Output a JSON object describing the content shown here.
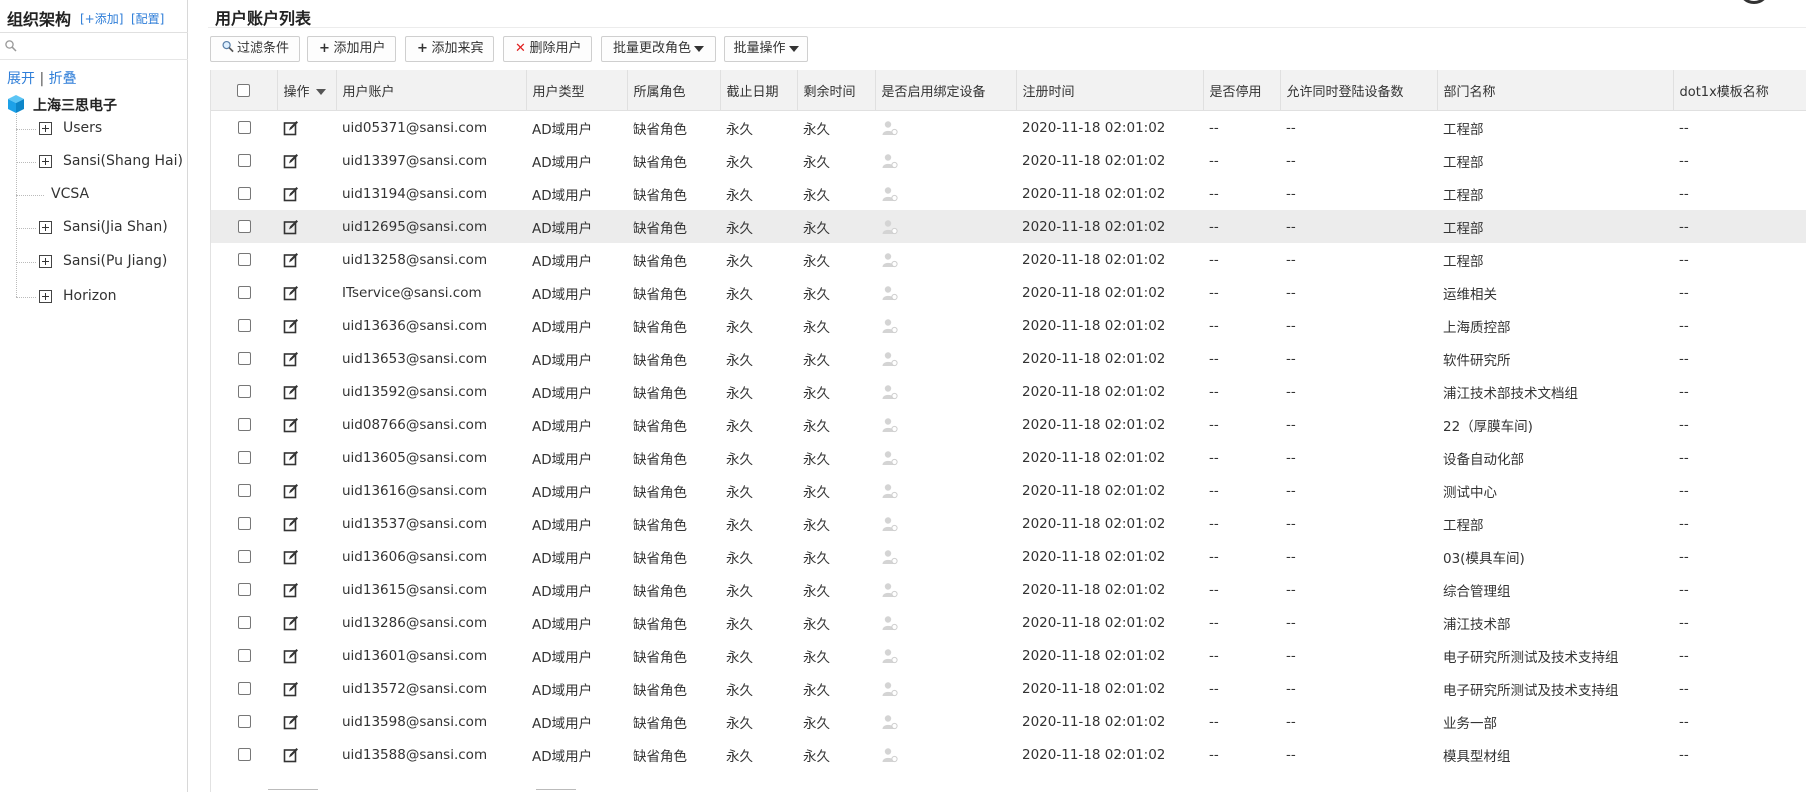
{
  "org": {
    "title": "组织架构",
    "add_label": "[+添加]",
    "config_label": "[配置]",
    "expand_label": "展开",
    "separator": "|",
    "collapse_label": "折叠",
    "root_label": "上海三思电子",
    "nodes": [
      {
        "label": "Users",
        "expandable": true
      },
      {
        "label": "Sansi(Shang Hai)",
        "expandable": true
      },
      {
        "label": "VCSA",
        "expandable": false
      },
      {
        "label": "Sansi(Jia Shan)",
        "expandable": true
      },
      {
        "label": "Sansi(Pu Jiang)",
        "expandable": true
      },
      {
        "label": "Horizon",
        "expandable": true
      }
    ]
  },
  "page": {
    "title": "用户账户列表"
  },
  "toolbar": {
    "filter": "过滤条件",
    "add_user": "添加用户",
    "add_guest": "添加来宾",
    "delete_user": "删除用户",
    "batch_role": "批量更改角色",
    "batch_ops": "批量操作"
  },
  "table": {
    "headers": {
      "op": "操作",
      "account": "用户账户",
      "type": "用户类型",
      "role": "所属角色",
      "deadline": "截止日期",
      "remaining": "剩余时间",
      "bind_device": "是否启用绑定设备",
      "reg_time": "注册时间",
      "disabled": "是否停用",
      "concurrent": "允许同时登陆设备数",
      "dept": "部门名称",
      "dot1x": "dot1x模板名称"
    },
    "rows": [
      {
        "account": "uid05371@sansi.com",
        "type": "AD域用户",
        "role": "缺省角色",
        "deadline": "永久",
        "remaining": "永久",
        "reg_time": "2020-11-18 02:01:02",
        "disabled": "--",
        "concurrent": "--",
        "dept": "工程部",
        "dot1x": "--"
      },
      {
        "account": "uid13397@sansi.com",
        "type": "AD域用户",
        "role": "缺省角色",
        "deadline": "永久",
        "remaining": "永久",
        "reg_time": "2020-11-18 02:01:02",
        "disabled": "--",
        "concurrent": "--",
        "dept": "工程部",
        "dot1x": "--"
      },
      {
        "account": "uid13194@sansi.com",
        "type": "AD域用户",
        "role": "缺省角色",
        "deadline": "永久",
        "remaining": "永久",
        "reg_time": "2020-11-18 02:01:02",
        "disabled": "--",
        "concurrent": "--",
        "dept": "工程部",
        "dot1x": "--"
      },
      {
        "account": "uid12695@sansi.com",
        "type": "AD域用户",
        "role": "缺省角色",
        "deadline": "永久",
        "remaining": "永久",
        "reg_time": "2020-11-18 02:01:02",
        "disabled": "--",
        "concurrent": "--",
        "dept": "工程部",
        "dot1x": "--"
      },
      {
        "account": "uid13258@sansi.com",
        "type": "AD域用户",
        "role": "缺省角色",
        "deadline": "永久",
        "remaining": "永久",
        "reg_time": "2020-11-18 02:01:02",
        "disabled": "--",
        "concurrent": "--",
        "dept": "工程部",
        "dot1x": "--"
      },
      {
        "account": "ITservice@sansi.com",
        "type": "AD域用户",
        "role": "缺省角色",
        "deadline": "永久",
        "remaining": "永久",
        "reg_time": "2020-11-18 02:01:02",
        "disabled": "--",
        "concurrent": "--",
        "dept": "运维相关",
        "dot1x": "--"
      },
      {
        "account": "uid13636@sansi.com",
        "type": "AD域用户",
        "role": "缺省角色",
        "deadline": "永久",
        "remaining": "永久",
        "reg_time": "2020-11-18 02:01:02",
        "disabled": "--",
        "concurrent": "--",
        "dept": "上海质控部",
        "dot1x": "--"
      },
      {
        "account": "uid13653@sansi.com",
        "type": "AD域用户",
        "role": "缺省角色",
        "deadline": "永久",
        "remaining": "永久",
        "reg_time": "2020-11-18 02:01:02",
        "disabled": "--",
        "concurrent": "--",
        "dept": "软件研究所",
        "dot1x": "--"
      },
      {
        "account": "uid13592@sansi.com",
        "type": "AD域用户",
        "role": "缺省角色",
        "deadline": "永久",
        "remaining": "永久",
        "reg_time": "2020-11-18 02:01:02",
        "disabled": "--",
        "concurrent": "--",
        "dept": "浦江技术部技术文档组",
        "dot1x": "--"
      },
      {
        "account": "uid08766@sansi.com",
        "type": "AD域用户",
        "role": "缺省角色",
        "deadline": "永久",
        "remaining": "永久",
        "reg_time": "2020-11-18 02:01:02",
        "disabled": "--",
        "concurrent": "--",
        "dept": "22（厚膜车间)",
        "dot1x": "--"
      },
      {
        "account": "uid13605@sansi.com",
        "type": "AD域用户",
        "role": "缺省角色",
        "deadline": "永久",
        "remaining": "永久",
        "reg_time": "2020-11-18 02:01:02",
        "disabled": "--",
        "concurrent": "--",
        "dept": "设备自动化部",
        "dot1x": "--"
      },
      {
        "account": "uid13616@sansi.com",
        "type": "AD域用户",
        "role": "缺省角色",
        "deadline": "永久",
        "remaining": "永久",
        "reg_time": "2020-11-18 02:01:02",
        "disabled": "--",
        "concurrent": "--",
        "dept": "测试中心",
        "dot1x": "--"
      },
      {
        "account": "uid13537@sansi.com",
        "type": "AD域用户",
        "role": "缺省角色",
        "deadline": "永久",
        "remaining": "永久",
        "reg_time": "2020-11-18 02:01:02",
        "disabled": "--",
        "concurrent": "--",
        "dept": "工程部",
        "dot1x": "--"
      },
      {
        "account": "uid13606@sansi.com",
        "type": "AD域用户",
        "role": "缺省角色",
        "deadline": "永久",
        "remaining": "永久",
        "reg_time": "2020-11-18 02:01:02",
        "disabled": "--",
        "concurrent": "--",
        "dept": "03(模具车间)",
        "dot1x": "--"
      },
      {
        "account": "uid13615@sansi.com",
        "type": "AD域用户",
        "role": "缺省角色",
        "deadline": "永久",
        "remaining": "永久",
        "reg_time": "2020-11-18 02:01:02",
        "disabled": "--",
        "concurrent": "--",
        "dept": "综合管理组",
        "dot1x": "--"
      },
      {
        "account": "uid13286@sansi.com",
        "type": "AD域用户",
        "role": "缺省角色",
        "deadline": "永久",
        "remaining": "永久",
        "reg_time": "2020-11-18 02:01:02",
        "disabled": "--",
        "concurrent": "--",
        "dept": "浦江技术部",
        "dot1x": "--"
      },
      {
        "account": "uid13601@sansi.com",
        "type": "AD域用户",
        "role": "缺省角色",
        "deadline": "永久",
        "remaining": "永久",
        "reg_time": "2020-11-18 02:01:02",
        "disabled": "--",
        "concurrent": "--",
        "dept": "电子研究所测试及技术支持组",
        "dot1x": "--"
      },
      {
        "account": "uid13572@sansi.com",
        "type": "AD域用户",
        "role": "缺省角色",
        "deadline": "永久",
        "remaining": "永久",
        "reg_time": "2020-11-18 02:01:02",
        "disabled": "--",
        "concurrent": "--",
        "dept": "电子研究所测试及技术支持组",
        "dot1x": "--"
      },
      {
        "account": "uid13598@sansi.com",
        "type": "AD域用户",
        "role": "缺省角色",
        "deadline": "永久",
        "remaining": "永久",
        "reg_time": "2020-11-18 02:01:02",
        "disabled": "--",
        "concurrent": "--",
        "dept": "业务一部",
        "dot1x": "--"
      },
      {
        "account": "uid13588@sansi.com",
        "type": "AD域用户",
        "role": "缺省角色",
        "deadline": "永久",
        "remaining": "永久",
        "reg_time": "2020-11-18 02:01:02",
        "disabled": "--",
        "concurrent": "--",
        "dept": "模具型材组",
        "dot1x": "--"
      }
    ],
    "highlighted_row": 3
  },
  "icons": {
    "search": "search-icon",
    "root": "cube-icon",
    "filter": "magnifier-icon",
    "add": "plus-icon",
    "delete": "red-x-icon",
    "edit": "edit-icon",
    "device": "user-device-icon"
  },
  "colors": {
    "link": "#2f7ed8",
    "delete": "#e02020",
    "cube": "#1da1e8",
    "header_bg": "#f2f2f2",
    "row_highlight": "#ececec"
  }
}
